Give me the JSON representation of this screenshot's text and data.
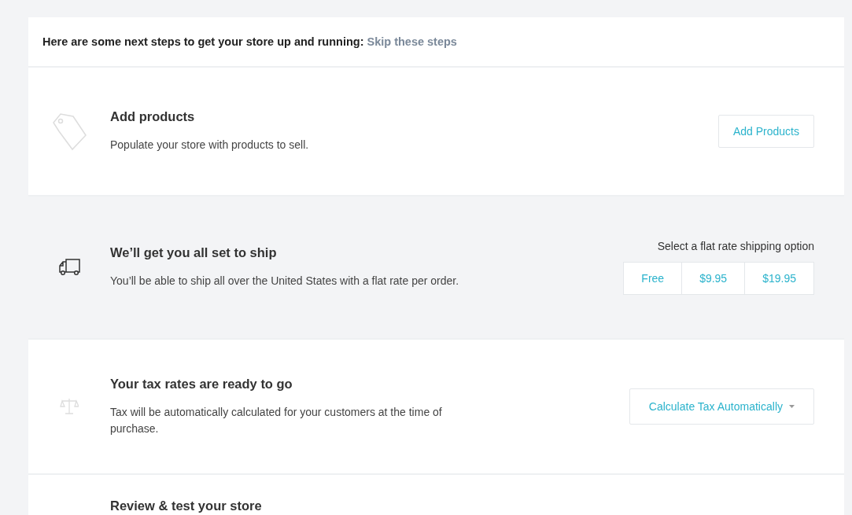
{
  "intro": {
    "text": "Here are some next steps to get your store up and running:",
    "link": "Skip these steps"
  },
  "steps": [
    {
      "title": "Add products",
      "description": "Populate your store with products to sell.",
      "highlighted": false,
      "action": {
        "kind": "button",
        "label": "Add Products"
      }
    },
    {
      "title": "We’ll get you all set to ship",
      "description": "You’ll be able to ship all over the United States with a flat rate per order.",
      "highlighted": true,
      "action": {
        "kind": "options",
        "caption": "Select a flat rate shipping option",
        "options": [
          "Free",
          "$9.95",
          "$19.95"
        ]
      }
    },
    {
      "title": "Your tax rates are ready to go",
      "description": "Tax will be automatically calculated for your customers at the time of purchase.",
      "highlighted": false,
      "action": {
        "kind": "dropdown",
        "label": "Calculate Tax Automatically"
      }
    },
    {
      "title": "Review & test your store",
      "highlighted": false
    }
  ]
}
